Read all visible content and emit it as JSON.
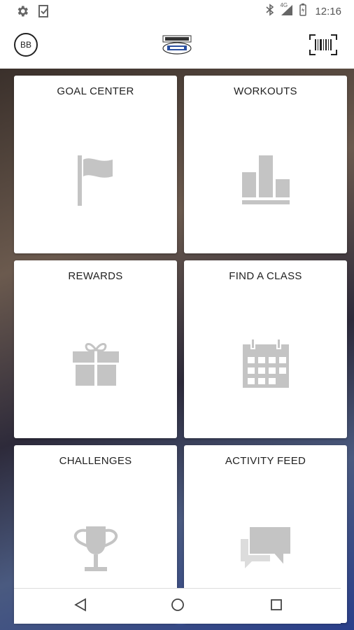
{
  "status_bar": {
    "network": "4G",
    "time": "12:16"
  },
  "app_bar": {
    "avatar_initials": "BB"
  },
  "tiles": [
    {
      "label": "GOAL CENTER"
    },
    {
      "label": "WORKOUTS"
    },
    {
      "label": "REWARDS"
    },
    {
      "label": "FIND A CLASS"
    },
    {
      "label": "CHALLENGES"
    },
    {
      "label": "ACTIVITY FEED"
    }
  ],
  "colors": {
    "icon_gray": "#c4c4c4",
    "text": "#222222"
  }
}
